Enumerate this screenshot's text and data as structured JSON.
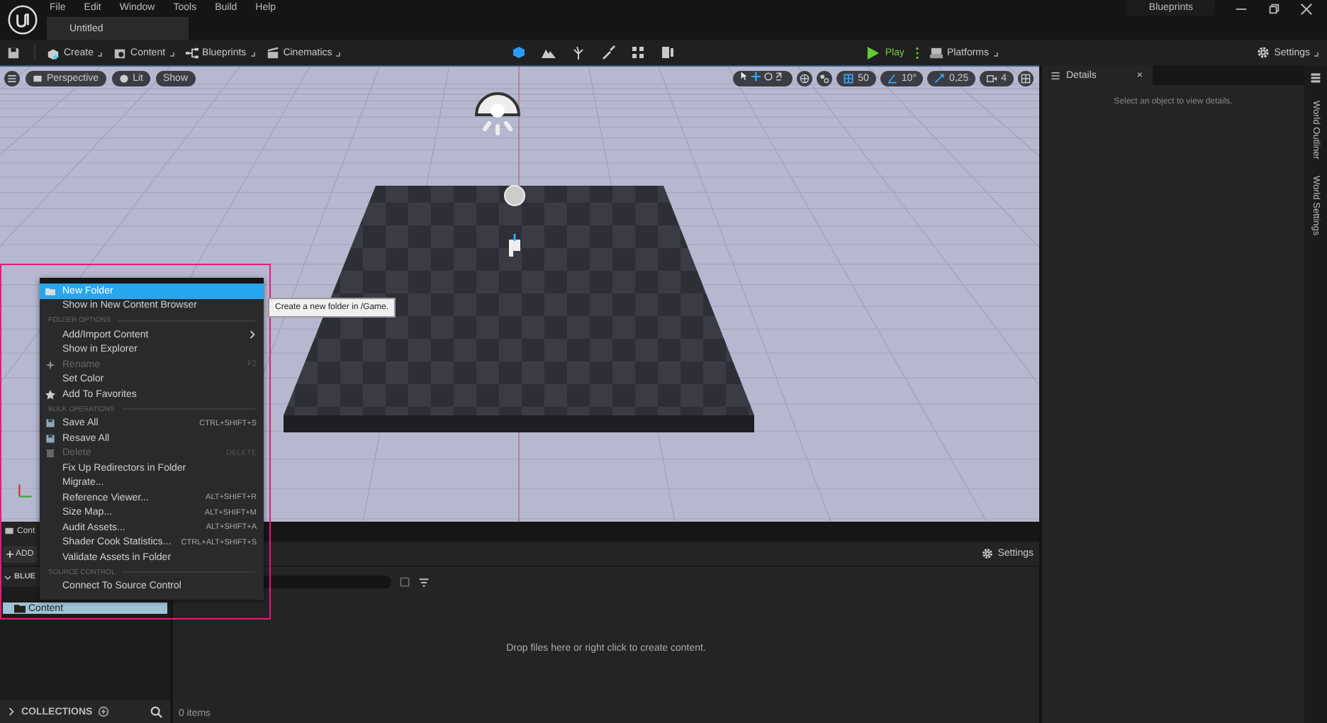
{
  "window": {
    "menu": [
      "File",
      "Edit",
      "Window",
      "Tools",
      "Build",
      "Help"
    ],
    "document_tab": {
      "label": "Untitled",
      "selected": true
    },
    "right_tab": {
      "label": "Blueprints"
    }
  },
  "toolbar": {
    "buttons": [
      {
        "label": "Create",
        "kind": "create"
      },
      {
        "label": "Content",
        "kind": "content"
      },
      {
        "label": "Blueprints",
        "kind": "blueprints"
      },
      {
        "label": "Cinematics",
        "kind": "cinematics"
      }
    ],
    "modes": [
      {
        "kind": "cube",
        "selected": true
      },
      {
        "kind": "mountain",
        "selected": false
      },
      {
        "kind": "plant",
        "selected": false
      },
      {
        "kind": "brush",
        "selected": false
      },
      {
        "kind": "tiles",
        "selected": false
      },
      {
        "kind": "panel",
        "selected": false
      }
    ],
    "play": {
      "label": "Play"
    },
    "platforms": {
      "label": "Platforms"
    },
    "settings": {
      "label": "Settings"
    }
  },
  "viewport": {
    "left_buttons": [
      {
        "label": "Perspective",
        "kind": "camera"
      },
      {
        "label": "Lit",
        "kind": "lit"
      },
      {
        "label": "Show",
        "kind": "plain"
      }
    ],
    "snap_values": [
      {
        "label": "50",
        "kind": "grid"
      },
      {
        "label": "10°",
        "kind": "angle"
      },
      {
        "label": "0,25",
        "kind": "scale"
      },
      {
        "label": "4",
        "kind": "camera"
      }
    ]
  },
  "context_menu": {
    "items": [
      {
        "kind": "folder",
        "label": "New Folder",
        "selected": true,
        "disabled": false
      },
      {
        "kind": "plain",
        "label": "Show in New Content Browser",
        "selected": false,
        "disabled": false
      },
      {
        "kind": "header",
        "label": "FOLDER OPTIONS"
      },
      {
        "kind": "submenu",
        "label": "Add/Import Content",
        "selected": false,
        "disabled": false
      },
      {
        "kind": "plain",
        "label": "Show in Explorer",
        "selected": false,
        "disabled": false
      },
      {
        "kind": "sparkle",
        "label": "Rename",
        "shortcut": "F2",
        "selected": false,
        "disabled": true
      },
      {
        "kind": "plain",
        "label": "Set Color",
        "selected": false,
        "disabled": false
      },
      {
        "kind": "star",
        "label": "Add To Favorites",
        "selected": false,
        "disabled": false
      },
      {
        "kind": "header",
        "label": "BULK OPERATIONS"
      },
      {
        "kind": "save",
        "label": "Save All",
        "shortcut": "CTRL+SHIFT+S",
        "selected": false,
        "disabled": false
      },
      {
        "kind": "save",
        "label": "Resave All",
        "selected": false,
        "disabled": false
      },
      {
        "kind": "trash",
        "label": "Delete",
        "shortcut": "DELETE",
        "selected": false,
        "disabled": true
      },
      {
        "kind": "plain",
        "label": "Fix Up Redirectors in Folder",
        "selected": false,
        "disabled": false
      },
      {
        "kind": "plain",
        "label": "Migrate...",
        "selected": false,
        "disabled": false
      },
      {
        "kind": "plain",
        "label": "Reference Viewer...",
        "shortcut": "ALT+SHIFT+R",
        "selected": false,
        "disabled": false
      },
      {
        "kind": "plain",
        "label": "Size Map...",
        "shortcut": "ALT+SHIFT+M",
        "selected": false,
        "disabled": false
      },
      {
        "kind": "plain",
        "label": "Audit Assets...",
        "shortcut": "ALT+SHIFT+A",
        "selected": false,
        "disabled": false
      },
      {
        "kind": "plain",
        "label": "Shader Cook Statistics...",
        "shortcut": "CTRL+ALT+SHIFT+S",
        "selected": false,
        "disabled": false
      },
      {
        "kind": "plain",
        "label": "Validate Assets in Folder",
        "selected": false,
        "disabled": false
      },
      {
        "kind": "header",
        "label": "SOURCE CONTROL"
      },
      {
        "kind": "plain",
        "label": "Connect To Source Control",
        "selected": false,
        "disabled": false
      }
    ]
  },
  "tooltip": "Create a new folder in /Game.",
  "content_browser": {
    "tab": "Cont",
    "add_button": "ADD",
    "settings": "Settings",
    "tree": {
      "root": "BLUE",
      "expanded": true,
      "folders": [
        {
          "label": "Content",
          "selected": true
        }
      ]
    },
    "collections": {
      "label": "COLLECTIONS",
      "expanded": false
    },
    "empty_message": "Drop files here or right click to create content.",
    "item_count": "0 items"
  },
  "details": {
    "tab": "Details",
    "close": "×",
    "message": "Select an object to view details."
  },
  "side_tabs": [
    "World Outliner",
    "World Settings"
  ]
}
